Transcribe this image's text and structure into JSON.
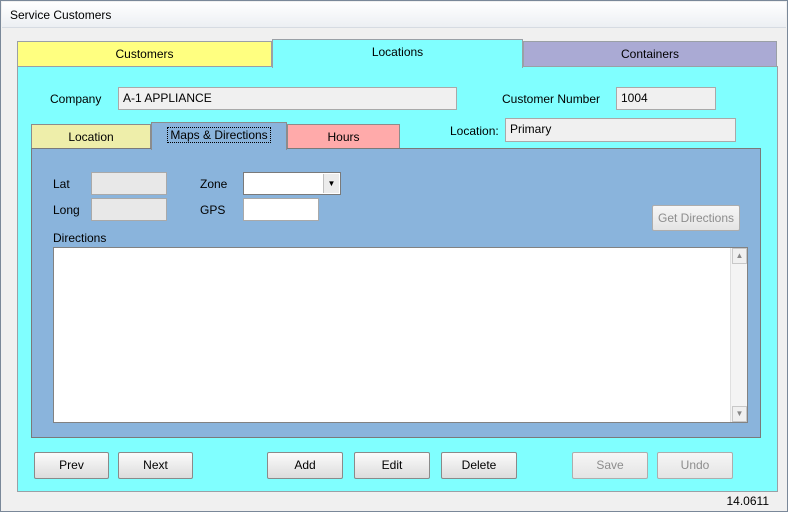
{
  "window": {
    "title": "Service Customers"
  },
  "tabs": {
    "customers": "Customers",
    "locations": "Locations",
    "containers": "Containers",
    "active": "Locations"
  },
  "company": {
    "label": "Company",
    "value": "A-1 APPLIANCE"
  },
  "customer_number": {
    "label": "Customer Number",
    "value": "1004"
  },
  "location": {
    "label": "Location:",
    "value": "Primary"
  },
  "subtabs": {
    "location": "Location",
    "maps": "Maps & Directions",
    "hours": "Hours",
    "active": "Maps & Directions"
  },
  "maps": {
    "lat_label": "Lat",
    "lat_value": "",
    "long_label": "Long",
    "long_value": "",
    "zone_label": "Zone",
    "zone_value": "",
    "gps_label": "GPS",
    "gps_value": "",
    "get_directions": "Get Directions",
    "directions_label": "Directions",
    "directions_value": ""
  },
  "buttons": {
    "prev": "Prev",
    "next": "Next",
    "add": "Add",
    "edit": "Edit",
    "delete": "Delete",
    "save": "Save",
    "undo": "Undo"
  },
  "version": "14.0611",
  "colors": {
    "customers_tab": "#ffff80",
    "locations_panel": "#80ffff",
    "containers_tab": "#aaaad4",
    "location_subtab": "#eeeeaa",
    "maps_panel": "#8ab4dc",
    "hours_subtab": "#ffaaaa"
  }
}
